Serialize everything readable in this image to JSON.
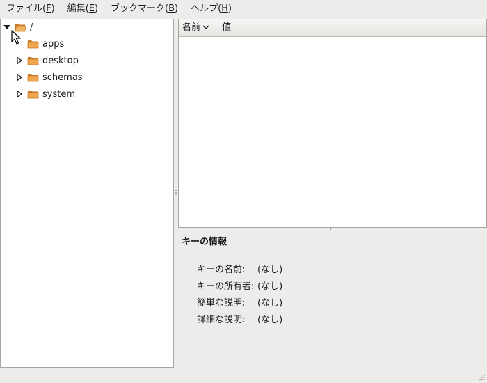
{
  "menubar": {
    "items": [
      {
        "label": "ファイル(",
        "mnemonic": "F",
        "suffix": ")"
      },
      {
        "label": "編集(",
        "mnemonic": "E",
        "suffix": ")"
      },
      {
        "label": "ブックマーク(",
        "mnemonic": "B",
        "suffix": ")"
      },
      {
        "label": "ヘルプ(",
        "mnemonic": "H",
        "suffix": ")"
      }
    ]
  },
  "tree": {
    "root": {
      "label": "/",
      "expanded": true
    },
    "children": [
      {
        "label": "apps"
      },
      {
        "label": "desktop"
      },
      {
        "label": "schemas"
      },
      {
        "label": "system"
      }
    ]
  },
  "list": {
    "columns": [
      {
        "label": "名前",
        "sorted": "descending"
      },
      {
        "label": "値"
      }
    ],
    "rows": []
  },
  "key_info": {
    "title": "キーの情報",
    "fields": [
      {
        "label": "キーの名前:",
        "value": "(なし)"
      },
      {
        "label": "キーの所有者:",
        "value": "(なし)"
      },
      {
        "label": "簡単な説明:",
        "value": "(なし)"
      },
      {
        "label": "詳細な説明:",
        "value": "(なし)"
      }
    ]
  },
  "icons": {
    "folder_color": "#e8a04a",
    "expander": "triangle-icon",
    "cursor": "mouse-pointer-icon"
  }
}
